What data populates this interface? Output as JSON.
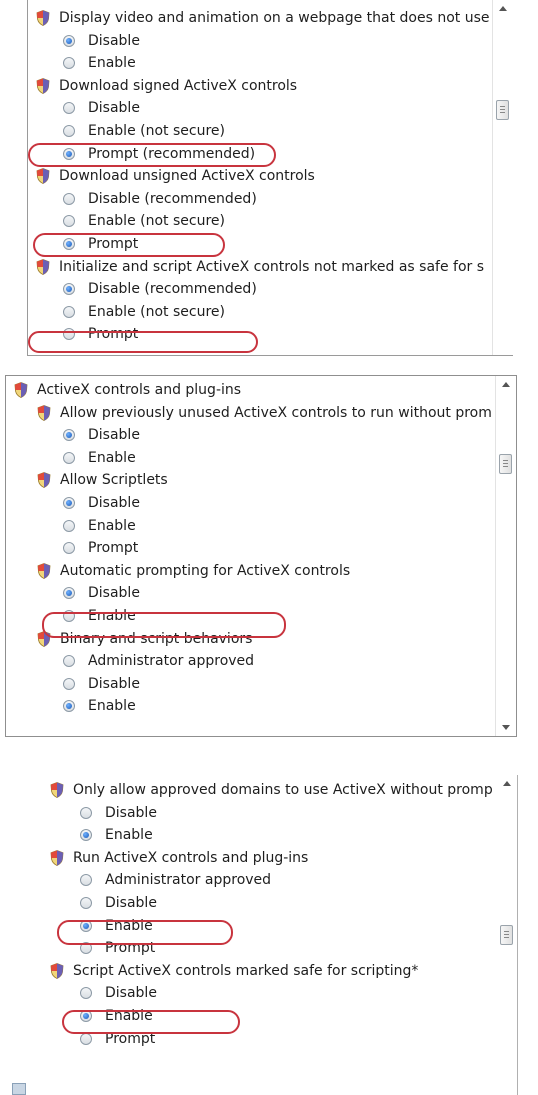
{
  "panel1": {
    "items": [
      {
        "kind": "heading",
        "text": "Display video and animation on a webpage that does not use"
      },
      {
        "kind": "option",
        "text": "Disable",
        "selected": true
      },
      {
        "kind": "option",
        "text": "Enable",
        "selected": false
      },
      {
        "kind": "heading",
        "text": "Download signed ActiveX controls"
      },
      {
        "kind": "option",
        "text": "Disable",
        "selected": false
      },
      {
        "kind": "option",
        "text": "Enable (not secure)",
        "selected": false
      },
      {
        "kind": "option",
        "text": "Prompt (recommended)",
        "selected": true
      },
      {
        "kind": "heading",
        "text": "Download unsigned ActiveX controls"
      },
      {
        "kind": "option",
        "text": "Disable (recommended)",
        "selected": false
      },
      {
        "kind": "option",
        "text": "Enable (not secure)",
        "selected": false
      },
      {
        "kind": "option",
        "text": "Prompt",
        "selected": true
      },
      {
        "kind": "heading",
        "text": "Initialize and script ActiveX controls not marked as safe for s"
      },
      {
        "kind": "option",
        "text": "Disable (recommended)",
        "selected": true
      },
      {
        "kind": "option",
        "text": "Enable (not secure)",
        "selected": false
      },
      {
        "kind": "option",
        "text": "Prompt",
        "selected": false
      }
    ]
  },
  "panel2": {
    "items": [
      {
        "kind": "category",
        "text": "ActiveX controls and plug-ins"
      },
      {
        "kind": "heading",
        "text": "Allow previously unused ActiveX controls to run without prom"
      },
      {
        "kind": "option",
        "text": "Disable",
        "selected": true
      },
      {
        "kind": "option",
        "text": "Enable",
        "selected": false
      },
      {
        "kind": "heading",
        "text": "Allow Scriptlets"
      },
      {
        "kind": "option",
        "text": "Disable",
        "selected": true
      },
      {
        "kind": "option",
        "text": "Enable",
        "selected": false
      },
      {
        "kind": "option",
        "text": "Prompt",
        "selected": false
      },
      {
        "kind": "heading",
        "text": "Automatic prompting for ActiveX controls"
      },
      {
        "kind": "option",
        "text": "Disable",
        "selected": true
      },
      {
        "kind": "option",
        "text": "Enable",
        "selected": false
      },
      {
        "kind": "heading",
        "text": "Binary and script behaviors"
      },
      {
        "kind": "option",
        "text": "Administrator approved",
        "selected": false
      },
      {
        "kind": "option",
        "text": "Disable",
        "selected": false
      },
      {
        "kind": "option",
        "text": "Enable",
        "selected": true
      }
    ]
  },
  "panel3": {
    "items": [
      {
        "kind": "heading",
        "text": "Only allow approved domains to use ActiveX without prompt"
      },
      {
        "kind": "option",
        "text": "Disable",
        "selected": false
      },
      {
        "kind": "option",
        "text": "Enable",
        "selected": true
      },
      {
        "kind": "heading",
        "text": "Run ActiveX controls and plug-ins"
      },
      {
        "kind": "option",
        "text": "Administrator approved",
        "selected": false
      },
      {
        "kind": "option",
        "text": "Disable",
        "selected": false
      },
      {
        "kind": "option",
        "text": "Enable",
        "selected": true
      },
      {
        "kind": "option",
        "text": "Prompt",
        "selected": false
      },
      {
        "kind": "heading",
        "text": "Script ActiveX controls marked safe for scripting*"
      },
      {
        "kind": "option",
        "text": "Disable",
        "selected": false
      },
      {
        "kind": "option",
        "text": "Enable",
        "selected": true
      },
      {
        "kind": "option",
        "text": "Prompt",
        "selected": false
      }
    ]
  },
  "colors": {
    "highlight": "#c8343e",
    "radio_selected": "#1a58b5"
  },
  "icons": {
    "setting": "shield-icon",
    "option": "radio-icon"
  }
}
